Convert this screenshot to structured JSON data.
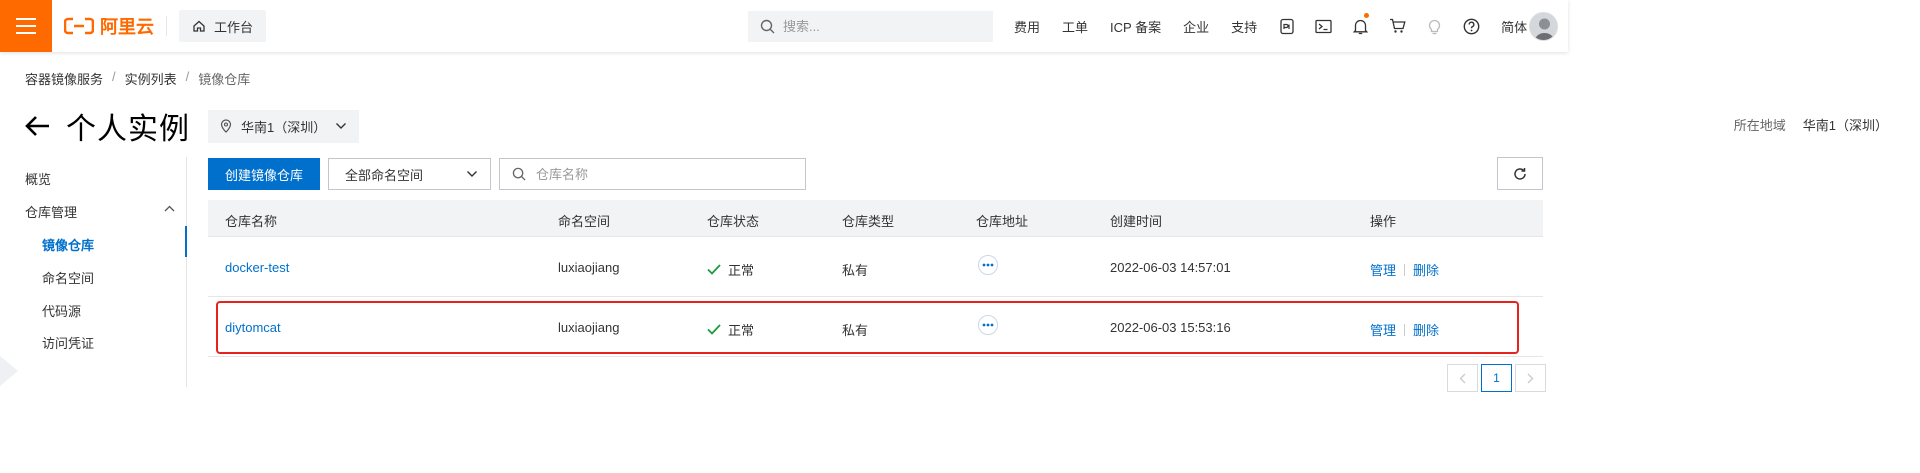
{
  "header": {
    "brand": "阿里云",
    "workbench": "工作台",
    "search_placeholder": "搜索...",
    "nav_links": [
      "费用",
      "工单",
      "ICP 备案",
      "企业",
      "支持"
    ],
    "language": "简体",
    "icons": [
      "ai-assistant-icon",
      "terminal-icon",
      "bell-icon",
      "cart-icon",
      "lightbulb-icon",
      "help-icon"
    ],
    "accent_color": "#ff6a00"
  },
  "breadcrumb": [
    "容器镜像服务",
    "实例列表",
    "镜像仓库"
  ],
  "page": {
    "title": "个人实例",
    "region": "华南1（深圳）",
    "region_label": "所在地域",
    "region_value": "华南1（深圳）"
  },
  "sidebar": {
    "overview": "概览",
    "repo_group": "仓库管理",
    "items": [
      "镜像仓库",
      "命名空间",
      "代码源",
      "访问凭证"
    ],
    "active_item": "镜像仓库"
  },
  "toolbar": {
    "create_button": "创建镜像仓库",
    "namespace_select": "全部命名空间",
    "search_placeholder": "仓库名称"
  },
  "table": {
    "columns": [
      "仓库名称",
      "命名空间",
      "仓库状态",
      "仓库类型",
      "仓库地址",
      "创建时间",
      "操作"
    ],
    "rows": [
      {
        "name": "docker-test",
        "namespace": "luxiaojiang",
        "status": "正常",
        "type": "私有",
        "created": "2022-06-03 14:57:01",
        "manage": "管理",
        "delete": "删除"
      },
      {
        "name": "diytomcat",
        "namespace": "luxiaojiang",
        "status": "正常",
        "type": "私有",
        "created": "2022-06-03 15:53:16",
        "manage": "管理",
        "delete": "删除"
      }
    ]
  },
  "pagination": {
    "current_page": "1"
  },
  "colors": {
    "primary": "#0070cc",
    "success": "#1b9a3c",
    "highlight": "#e8231e"
  }
}
